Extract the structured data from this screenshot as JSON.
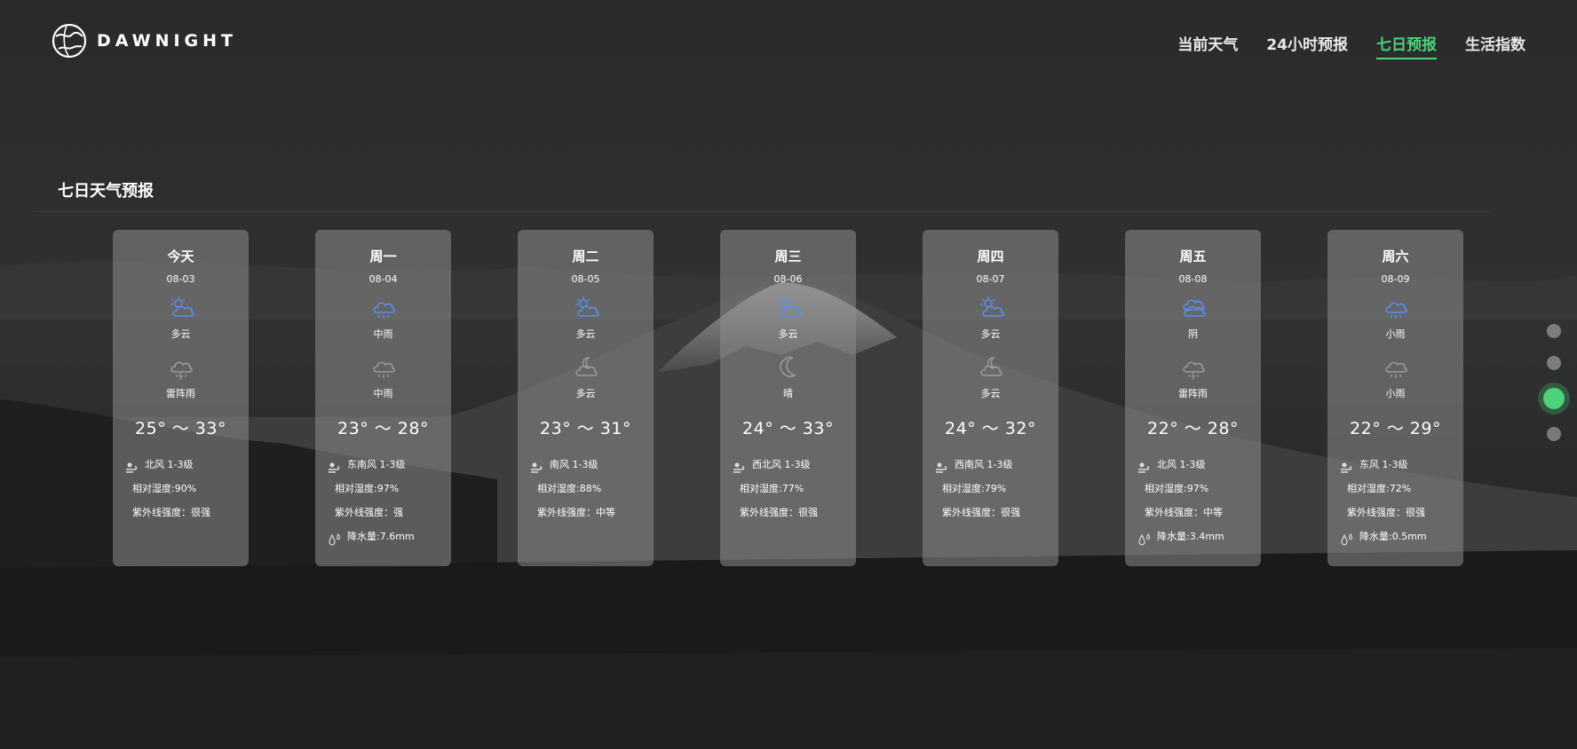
{
  "app": {
    "logo_text": "DAWNIGHT"
  },
  "nav": {
    "items": [
      {
        "label": "当前天气",
        "active": false
      },
      {
        "label": "24小时预报",
        "active": false
      },
      {
        "label": "七日预报",
        "active": true
      },
      {
        "label": "生活指数",
        "active": false
      }
    ]
  },
  "section": {
    "title": "七日天气预报"
  },
  "days": [
    {
      "day": "今天",
      "date": "08-03",
      "day_icon": "partly-cloudy-icon",
      "day_desc": "多云",
      "night_icon": "thunder-rain-icon",
      "night_desc": "雷阵雨",
      "temp": "25° ～ 33°",
      "wind": "北风 1-3级",
      "humidity": "相对湿度:90%",
      "uv": "紫外线强度：很强",
      "precip": ""
    },
    {
      "day": "周一",
      "date": "08-04",
      "day_icon": "rain-icon",
      "day_desc": "中雨",
      "night_icon": "rain-icon",
      "night_desc": "中雨",
      "temp": "23° ～ 28°",
      "wind": "东南风 1-3级",
      "humidity": "相对湿度:97%",
      "uv": "紫外线强度：强",
      "precip": "降水量:7.6mm"
    },
    {
      "day": "周二",
      "date": "08-05",
      "day_icon": "partly-cloudy-icon",
      "day_desc": "多云",
      "night_icon": "partly-cloudy-night-icon",
      "night_desc": "多云",
      "temp": "23° ～ 31°",
      "wind": "南风 1-3级",
      "humidity": "相对湿度:88%",
      "uv": "紫外线强度：中等",
      "precip": ""
    },
    {
      "day": "周三",
      "date": "08-06",
      "day_icon": "partly-cloudy-icon",
      "day_desc": "多云",
      "night_icon": "moon-icon",
      "night_desc": "晴",
      "temp": "24° ～ 33°",
      "wind": "西北风 1-3级",
      "humidity": "相对湿度:77%",
      "uv": "紫外线强度：很强",
      "precip": ""
    },
    {
      "day": "周四",
      "date": "08-07",
      "day_icon": "partly-cloudy-icon",
      "day_desc": "多云",
      "night_icon": "partly-cloudy-night-icon",
      "night_desc": "多云",
      "temp": "24° ～ 32°",
      "wind": "西南风 1-3级",
      "humidity": "相对湿度:79%",
      "uv": "紫外线强度：很强",
      "precip": ""
    },
    {
      "day": "周五",
      "date": "08-08",
      "day_icon": "overcast-icon",
      "day_desc": "阴",
      "night_icon": "thunder-rain-icon",
      "night_desc": "雷阵雨",
      "temp": "22° ～ 28°",
      "wind": "北风 1-3级",
      "humidity": "相对湿度:97%",
      "uv": "紫外线强度：中等",
      "precip": "降水量:3.4mm"
    },
    {
      "day": "周六",
      "date": "08-09",
      "day_icon": "rain-icon",
      "day_desc": "小雨",
      "night_icon": "rain-icon",
      "night_desc": "小雨",
      "temp": "22° ～ 29°",
      "wind": "东风 1-3级",
      "humidity": "相对湿度:72%",
      "uv": "紫外线强度：很强",
      "precip": "降水量:0.5mm"
    }
  ],
  "pager": {
    "count": 4,
    "active_index": 2
  },
  "colors": {
    "accent": "#4bd27a",
    "day_icon": "#5b8ff0",
    "night_icon": "#9a9a9a"
  }
}
